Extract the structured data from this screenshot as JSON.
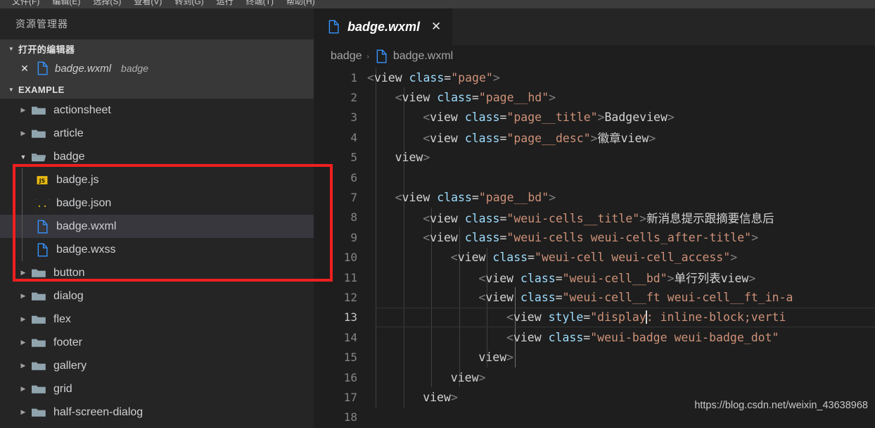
{
  "menubar": {
    "items": [
      "文件(F)",
      "编辑(E)",
      "选择(S)",
      "查看(V)",
      "转到(G)",
      "运行",
      "终端(T)",
      "帮助(H)"
    ]
  },
  "sidebar": {
    "title": "资源管理器",
    "open_editors": {
      "label": "打开的编辑器",
      "items": [
        {
          "close": "✕",
          "icon": "wxml-file-icon",
          "name": "badge.wxml",
          "folder": "badge"
        }
      ]
    },
    "explorer": {
      "label": "EXAMPLE",
      "items": [
        {
          "name": "actionsheet",
          "type": "folder",
          "state": "collapsed",
          "depth": 1
        },
        {
          "name": "article",
          "type": "folder",
          "state": "collapsed",
          "depth": 1
        },
        {
          "name": "badge",
          "type": "folder",
          "state": "expanded",
          "depth": 1
        },
        {
          "name": "badge.js",
          "type": "js",
          "depth": 2
        },
        {
          "name": "badge.json",
          "type": "json",
          "depth": 2
        },
        {
          "name": "badge.wxml",
          "type": "wxml",
          "depth": 2,
          "selected": true
        },
        {
          "name": "badge.wxss",
          "type": "wxml",
          "depth": 2
        },
        {
          "name": "button",
          "type": "folder",
          "state": "collapsed",
          "depth": 1
        },
        {
          "name": "dialog",
          "type": "folder",
          "state": "collapsed",
          "depth": 1
        },
        {
          "name": "flex",
          "type": "folder",
          "state": "collapsed",
          "depth": 1
        },
        {
          "name": "footer",
          "type": "folder",
          "state": "collapsed",
          "depth": 1
        },
        {
          "name": "gallery",
          "type": "folder",
          "state": "collapsed",
          "depth": 1
        },
        {
          "name": "grid",
          "type": "folder",
          "state": "collapsed",
          "depth": 1
        },
        {
          "name": "half-screen-dialog",
          "type": "folder",
          "state": "collapsed",
          "depth": 1
        }
      ]
    }
  },
  "editor": {
    "tab": {
      "icon": "wxml-file-icon",
      "title": "badge.wxml",
      "close": "✕"
    },
    "breadcrumb": {
      "folder": "badge",
      "separator": "›",
      "file": "badge.wxml"
    },
    "cursor_line": 13,
    "lines": [
      {
        "n": "1",
        "indent": 0,
        "tokens": [
          [
            "punct",
            "<"
          ],
          [
            "tag",
            "view"
          ],
          [
            "sp",
            " "
          ],
          [
            "attr",
            "class"
          ],
          [
            "eq",
            "="
          ],
          [
            "str",
            "\"page\""
          ],
          [
            "punct",
            ">"
          ]
        ]
      },
      {
        "n": "2",
        "indent": 1,
        "tokens": [
          [
            "punct",
            "<"
          ],
          [
            "tag",
            "view"
          ],
          [
            "sp",
            " "
          ],
          [
            "attr",
            "class"
          ],
          [
            "eq",
            "="
          ],
          [
            "str",
            "\"page__hd\""
          ],
          [
            "punct",
            ">"
          ]
        ]
      },
      {
        "n": "3",
        "indent": 2,
        "tokens": [
          [
            "punct",
            "<"
          ],
          [
            "tag",
            "view"
          ],
          [
            "sp",
            " "
          ],
          [
            "attr",
            "class"
          ],
          [
            "eq",
            "="
          ],
          [
            "str",
            "\"page__title\""
          ],
          [
            "punct",
            ">"
          ],
          [
            "text",
            "Badge"
          ],
          [
            "punct",
            "</"
          ],
          [
            "tag",
            "view"
          ],
          [
            "punct",
            ">"
          ]
        ]
      },
      {
        "n": "4",
        "indent": 2,
        "tokens": [
          [
            "punct",
            "<"
          ],
          [
            "tag",
            "view"
          ],
          [
            "sp",
            " "
          ],
          [
            "attr",
            "class"
          ],
          [
            "eq",
            "="
          ],
          [
            "str",
            "\"page__desc\""
          ],
          [
            "punct",
            ">"
          ],
          [
            "text",
            "徽章"
          ],
          [
            "punct",
            "</"
          ],
          [
            "tag",
            "view"
          ],
          [
            "punct",
            ">"
          ]
        ]
      },
      {
        "n": "5",
        "indent": 1,
        "tokens": [
          [
            "punct",
            "</"
          ],
          [
            "tag",
            "view"
          ],
          [
            "punct",
            ">"
          ]
        ]
      },
      {
        "n": "6",
        "indent": 0,
        "tokens": []
      },
      {
        "n": "7",
        "indent": 1,
        "tokens": [
          [
            "punct",
            "<"
          ],
          [
            "tag",
            "view"
          ],
          [
            "sp",
            " "
          ],
          [
            "attr",
            "class"
          ],
          [
            "eq",
            "="
          ],
          [
            "str",
            "\"page__bd\""
          ],
          [
            "punct",
            ">"
          ]
        ]
      },
      {
        "n": "8",
        "indent": 2,
        "tokens": [
          [
            "punct",
            "<"
          ],
          [
            "tag",
            "view"
          ],
          [
            "sp",
            " "
          ],
          [
            "attr",
            "class"
          ],
          [
            "eq",
            "="
          ],
          [
            "str",
            "\"weui-cells__title\""
          ],
          [
            "punct",
            ">"
          ],
          [
            "text",
            "新消息提示跟摘要信息后"
          ]
        ]
      },
      {
        "n": "9",
        "indent": 2,
        "tokens": [
          [
            "punct",
            "<"
          ],
          [
            "tag",
            "view"
          ],
          [
            "sp",
            " "
          ],
          [
            "attr",
            "class"
          ],
          [
            "eq",
            "="
          ],
          [
            "str",
            "\"weui-cells weui-cells_after-title\""
          ],
          [
            "punct",
            ">"
          ]
        ]
      },
      {
        "n": "10",
        "indent": 3,
        "tokens": [
          [
            "punct",
            "<"
          ],
          [
            "tag",
            "view"
          ],
          [
            "sp",
            " "
          ],
          [
            "attr",
            "class"
          ],
          [
            "eq",
            "="
          ],
          [
            "str",
            "\"weui-cell weui-cell_access\""
          ],
          [
            "punct",
            ">"
          ]
        ]
      },
      {
        "n": "11",
        "indent": 4,
        "tokens": [
          [
            "punct",
            "<"
          ],
          [
            "tag",
            "view"
          ],
          [
            "sp",
            " "
          ],
          [
            "attr",
            "class"
          ],
          [
            "eq",
            "="
          ],
          [
            "str",
            "\"weui-cell__bd\""
          ],
          [
            "punct",
            ">"
          ],
          [
            "text",
            "单行列表"
          ],
          [
            "punct",
            "</"
          ],
          [
            "tag",
            "view"
          ],
          [
            "punct",
            ">"
          ]
        ]
      },
      {
        "n": "12",
        "indent": 4,
        "tokens": [
          [
            "punct",
            "<"
          ],
          [
            "tag",
            "view"
          ],
          [
            "sp",
            " "
          ],
          [
            "attr",
            "class"
          ],
          [
            "eq",
            "="
          ],
          [
            "str",
            "\"weui-cell__ft weui-cell__ft_in-a"
          ]
        ]
      },
      {
        "n": "13",
        "indent": 5,
        "tokens": [
          [
            "punct",
            "<"
          ],
          [
            "tag",
            "view"
          ],
          [
            "sp",
            " "
          ],
          [
            "attr",
            "style"
          ],
          [
            "eq",
            "="
          ],
          [
            "str",
            "\"display"
          ],
          [
            "caret",
            ""
          ],
          [
            "str",
            ": inline-block;verti"
          ]
        ]
      },
      {
        "n": "14",
        "indent": 5,
        "tokens": [
          [
            "punct",
            "<"
          ],
          [
            "tag",
            "view"
          ],
          [
            "sp",
            " "
          ],
          [
            "attr",
            "class"
          ],
          [
            "eq",
            "="
          ],
          [
            "str",
            "\"weui-badge weui-badge_dot\""
          ]
        ]
      },
      {
        "n": "15",
        "indent": 4,
        "tokens": [
          [
            "punct",
            "</"
          ],
          [
            "tag",
            "view"
          ],
          [
            "punct",
            ">"
          ]
        ]
      },
      {
        "n": "16",
        "indent": 3,
        "tokens": [
          [
            "punct",
            "</"
          ],
          [
            "tag",
            "view"
          ],
          [
            "punct",
            ">"
          ]
        ]
      },
      {
        "n": "17",
        "indent": 2,
        "tokens": [
          [
            "punct",
            "</"
          ],
          [
            "tag",
            "view"
          ],
          [
            "punct",
            ">"
          ]
        ]
      },
      {
        "n": "18",
        "indent": 0,
        "tokens": []
      }
    ]
  },
  "watermark": "https://blog.csdn.net/weixin_43638968",
  "annotation": {
    "color": "#f01f1f",
    "label": "badge-folder-highlight-box"
  },
  "colors": {
    "sidebar_bg": "#252526",
    "editor_bg": "#1e1e1e",
    "selected_row": "#37373d",
    "section_bg": "#383838",
    "accent_blue": "#3794ff",
    "string": "#ce9178",
    "attribute": "#9cdcfe"
  }
}
